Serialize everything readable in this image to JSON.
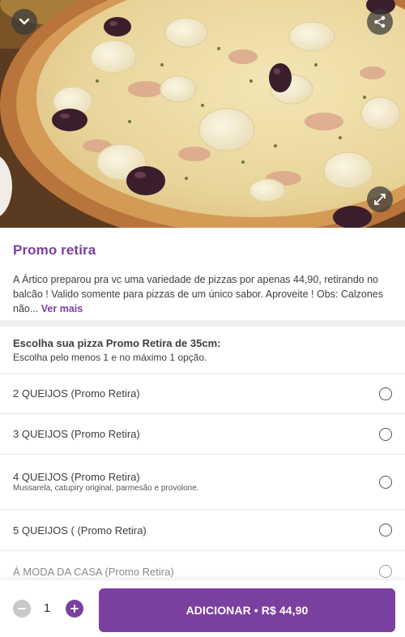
{
  "hero": {
    "back_icon": "chevron-down-icon",
    "share_icon": "share-icon",
    "expand_icon": "expand-icon"
  },
  "product": {
    "title": "Promo retira",
    "description": "A Ártico preparou pra vc uma variedade de pizzas por apenas 44,90, retirando no balcão ! Valido somente para pizzas de um único sabor. Aproveite ! Obs: Calzones não...",
    "more_label": "Ver mais"
  },
  "group": {
    "title": "Escolha sua pizza Promo Retira de 35cm:",
    "subtitle": "Escolha pelo menos 1 e no máximo 1 opção."
  },
  "options": [
    {
      "name": "2 QUEIJOS (Promo Retira)",
      "desc": ""
    },
    {
      "name": "3 QUEIJOS (Promo Retira)",
      "desc": ""
    },
    {
      "name": "4 QUEIJOS (Promo Retira)",
      "desc": "Mussarela, catupiry original, parmesão e provolone."
    },
    {
      "name": "5 QUEIJOS ( (Promo Retira)",
      "desc": ""
    },
    {
      "name": "Á MODA DA CASA (Promo Retira)",
      "desc": ""
    }
  ],
  "cart": {
    "quantity": "1",
    "add_label": "ADICIONAR • R$ 44,90"
  },
  "colors": {
    "accent": "#7b3fa0",
    "separator": "#efefef",
    "text": "#3e3e3e"
  }
}
